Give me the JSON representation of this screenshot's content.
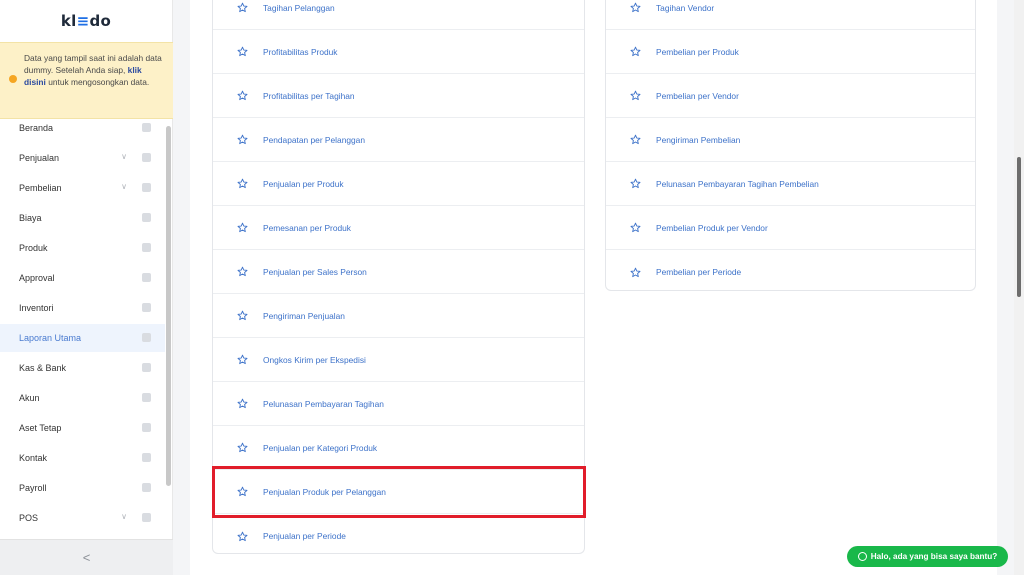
{
  "app": {
    "logo_prefix": "kl",
    "logo_mark": "≡",
    "logo_suffix": "do"
  },
  "notice": {
    "text_before": "Data yang tampil saat ini adalah data dummy. Setelah Anda siap, ",
    "link": "klik disini",
    "text_after": " untuk mengosongkan data."
  },
  "sidebar": {
    "items": [
      {
        "label": "Beranda",
        "icon": "home-icon",
        "chevron": false,
        "active": false
      },
      {
        "label": "Penjualan",
        "icon": "shopping-bag-icon",
        "chevron": true,
        "active": false
      },
      {
        "label": "Pembelian",
        "icon": "basket-icon",
        "chevron": true,
        "active": false
      },
      {
        "label": "Biaya",
        "icon": "credit-card-icon",
        "chevron": false,
        "active": false
      },
      {
        "label": "Produk",
        "icon": "box-icon",
        "chevron": false,
        "active": false
      },
      {
        "label": "Approval",
        "icon": "check-icon",
        "chevron": false,
        "active": false
      },
      {
        "label": "Inventori",
        "icon": "briefcase-icon",
        "chevron": false,
        "active": false
      },
      {
        "label": "Laporan Utama",
        "icon": "chart-icon",
        "chevron": false,
        "active": true
      },
      {
        "label": "Kas & Bank",
        "icon": "dollar-icon",
        "chevron": false,
        "active": false
      },
      {
        "label": "Akun",
        "icon": "ledger-icon",
        "chevron": false,
        "active": false
      },
      {
        "label": "Aset Tetap",
        "icon": "building-icon",
        "chevron": false,
        "active": false
      },
      {
        "label": "Kontak",
        "icon": "contact-card-icon",
        "chevron": false,
        "active": false
      },
      {
        "label": "Payroll",
        "icon": "payroll-icon",
        "chevron": false,
        "active": false
      },
      {
        "label": "POS",
        "icon": "pos-icon",
        "chevron": true,
        "active": false
      }
    ],
    "collapse_label": "<"
  },
  "reports": {
    "left": [
      "Tagihan Pelanggan",
      "Profitabilitas Produk",
      "Profitabilitas per Tagihan",
      "Pendapatan per Pelanggan",
      "Penjualan per Produk",
      "Pemesanan per Produk",
      "Penjualan per Sales Person",
      "Pengiriman Penjualan",
      "Ongkos Kirim per Ekspedisi",
      "Pelunasan Pembayaran Tagihan",
      "Penjualan per Kategori Produk",
      "Penjualan Produk per Pelanggan",
      "Penjualan per Periode"
    ],
    "right": [
      "Tagihan Vendor",
      "Pembelian per Produk",
      "Pembelian per Vendor",
      "Pengiriman Pembelian",
      "Pelunasan Pembayaran Tagihan Pembelian",
      "Pembelian Produk per Vendor",
      "Pembelian per Periode"
    ],
    "highlighted": "Penjualan Produk per Pelanggan"
  },
  "chat": {
    "label": "Halo, ada yang bisa saya bantu?"
  },
  "colors": {
    "link": "#3d72c9",
    "highlight": "#e11d2a",
    "chat": "#19b84a",
    "notice_bg": "#fdf1c8"
  }
}
